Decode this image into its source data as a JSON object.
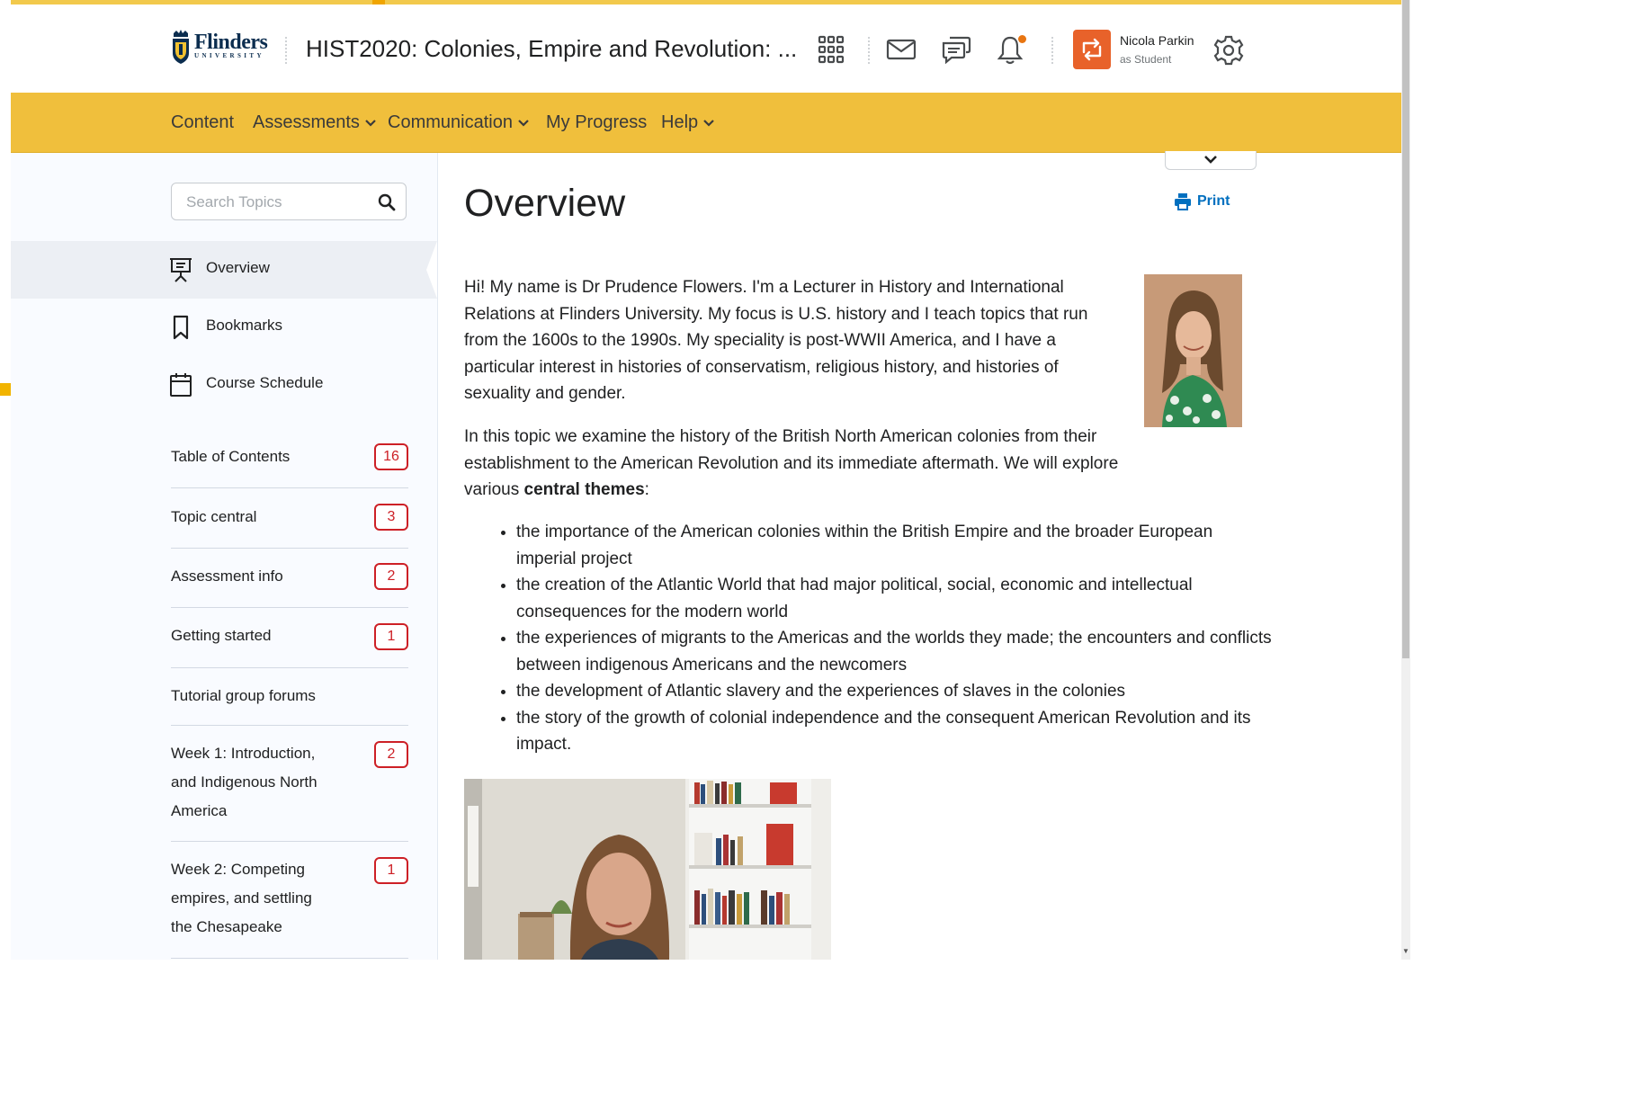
{
  "header": {
    "logo_name": "Flinders",
    "logo_sub": "UNIVERSITY",
    "course_title": "HIST2020: Colonies, Empire and Revolution: ...",
    "user_name": "Nicola Parkin",
    "user_role": "as Student",
    "icons": [
      "apps-grid-icon",
      "mail-icon",
      "chat-icon",
      "bell-icon",
      "role-switch-icon",
      "settings-gear-icon"
    ]
  },
  "nav": {
    "content": "Content",
    "assessments": "Assessments",
    "communication": "Communication",
    "my_progress": "My Progress",
    "help": "Help"
  },
  "sidebar": {
    "search_placeholder": "Search Topics",
    "overview": "Overview",
    "bookmarks": "Bookmarks",
    "course_schedule": "Course Schedule",
    "toc": [
      {
        "label": "Table of Contents",
        "count": "16"
      },
      {
        "label": "Topic central",
        "count": "3"
      },
      {
        "label": "Assessment info",
        "count": "2"
      },
      {
        "label": "Getting started",
        "count": "1"
      },
      {
        "label": "Tutorial group forums",
        "count": ""
      },
      {
        "label": "Week 1: Introduction, and Indigenous North America",
        "count": "2"
      },
      {
        "label": "Week 2: Competing empires, and settling the Chesapeake",
        "count": "1"
      }
    ]
  },
  "main": {
    "title": "Overview",
    "print_label": "Print",
    "intro": "Hi! My name is Dr Prudence Flowers. I'm a Lecturer in History and International Relations at Flinders University. My focus is U.S. history and I teach topics that run from the 1600s to the 1990s. My speciality is post-WWII America, and I have a particular interest in histories of conservatism, religious history, and histories of sexuality and gender.",
    "topic_before": "In this topic we examine the history of the British North American colonies from their establishment to the American Revolution and its immediate aftermath. We will explore various ",
    "topic_bold": "central themes",
    "topic_after": ":",
    "bullets": [
      "the importance of the American colonies within the British Empire and the broader European imperial project",
      "the creation of the Atlantic World that had major political, social, economic and intellectual consequences for the modern world",
      "the experiences of migrants to the Americas and the worlds they made; the encounters and conflicts between indigenous Americans and the newcomers",
      "the development of Atlantic slavery and the experiences of slaves in the colonies",
      "the story of the growth of colonial independence and the consequent American Revolution and its impact."
    ]
  },
  "colors": {
    "nav_bar": "#f0bf3c",
    "badge": "#cd2026",
    "link": "#006fbf",
    "role_avatar": "#e8622a",
    "notification_dot": "#e87511"
  }
}
